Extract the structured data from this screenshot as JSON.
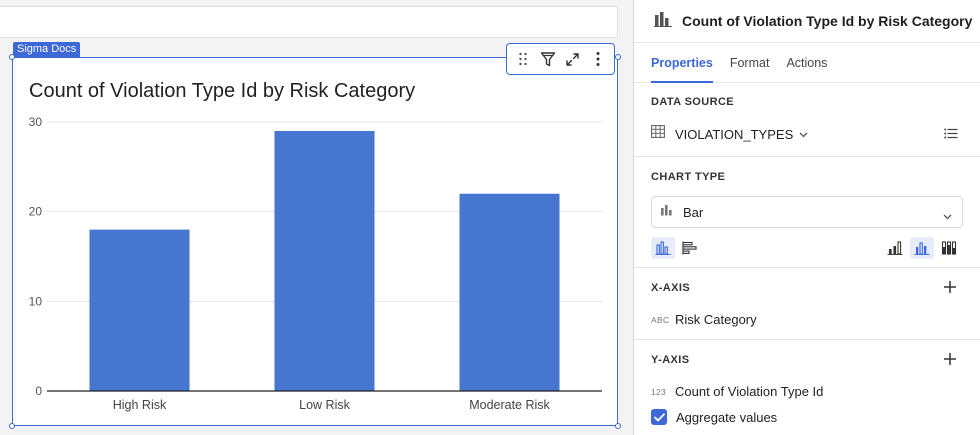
{
  "canvas": {
    "doc_tag": "Sigma Docs",
    "chart_title": "Count of Violation Type Id by Risk Category",
    "toolbar": {
      "icons": [
        "drag-handle-icon",
        "filter-icon",
        "expand-icon",
        "more-options-icon"
      ]
    }
  },
  "chart_data": {
    "type": "bar",
    "title": "Count of Violation Type Id by Risk Category",
    "categories": [
      "High Risk",
      "Low Risk",
      "Moderate Risk"
    ],
    "values": [
      18,
      29,
      22
    ],
    "xlabel": "",
    "ylabel": "",
    "ylim": [
      0,
      30
    ],
    "yticks": [
      0,
      10,
      20,
      30
    ],
    "grid": true,
    "bar_color": "#4676d0"
  },
  "panel": {
    "title": "Count of Violation Type Id by Risk Category",
    "tabs": [
      {
        "label": "Properties",
        "active": true
      },
      {
        "label": "Format",
        "active": false
      },
      {
        "label": "Actions",
        "active": false
      }
    ],
    "data_source": {
      "label": "DATA SOURCE",
      "value": "VIOLATION_TYPES"
    },
    "chart_type": {
      "label": "CHART TYPE",
      "value": "Bar"
    },
    "x_axis": {
      "label": "X-AXIS",
      "field_type": "ABC",
      "field_name": "Risk Category"
    },
    "y_axis": {
      "label": "Y-AXIS",
      "field_type": "123",
      "field_name": "Count of Violation Type Id"
    },
    "aggregate": {
      "label": "Aggregate values",
      "checked": true
    }
  },
  "colors": {
    "accent": "#3d68d8",
    "bar": "#4676d0"
  }
}
